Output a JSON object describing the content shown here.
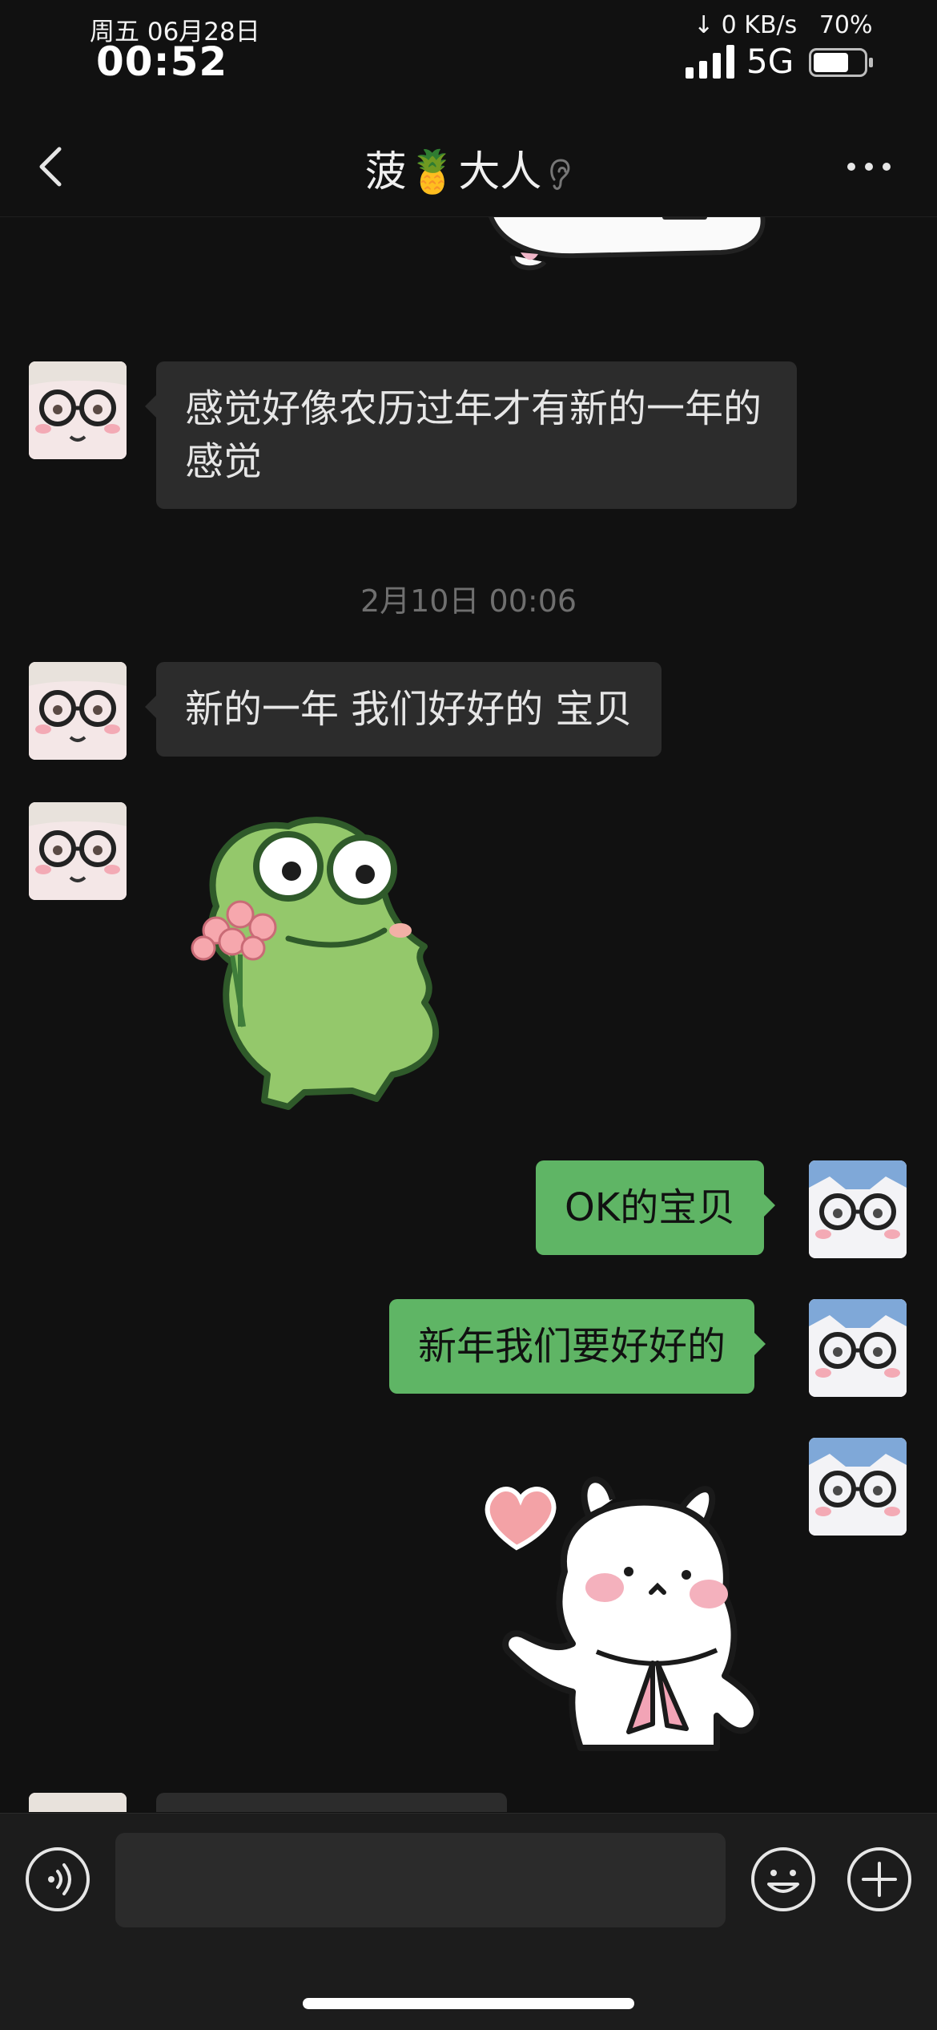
{
  "status_bar": {
    "date": "周五 06月28日",
    "time": "00:52",
    "speed": "↓ 0 KB/s",
    "battery_text": "70%",
    "network": "5G",
    "battery_level": 0.7
  },
  "nav": {
    "title": "菠🍍大人",
    "back_icon": "chevron-left-icon",
    "more_icon": "more-dots-icon",
    "title_icon": "ear-icon"
  },
  "messages": {
    "m1": "感觉好像农历过年才有新的一年的感觉",
    "ts1": "2月10日 00:06",
    "m2": "新的一年 我们好好的 宝贝",
    "m3_sticker": "frog-with-flowers-sticker",
    "m4": "OK的宝贝",
    "m5": "新年我们要好好的",
    "m6_sticker": "bunny-with-heart-sticker"
  },
  "input_bar": {
    "voice_icon": "voice-icon",
    "emoji_icon": "emoji-icon",
    "plus_icon": "plus-icon"
  },
  "colors": {
    "background": "#111111",
    "bubble_other": "#2c2c2c",
    "bubble_me": "#5fb565",
    "input_bar": "#1c1c1c"
  }
}
